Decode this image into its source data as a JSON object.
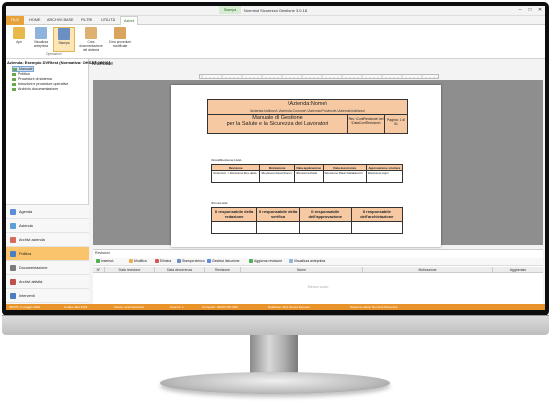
{
  "window": {
    "title": "Normind Sicurezza Gestione 3.0.18",
    "context_tab": "Stampa",
    "controls": {
      "minimize": "–",
      "maximize": "□",
      "close": "✕"
    }
  },
  "tabs": [
    {
      "label": "FILE"
    },
    {
      "label": "HOME"
    },
    {
      "label": "ARCHIVI BASE"
    },
    {
      "label": "FILTRI"
    },
    {
      "label": "UTILITÀ"
    },
    {
      "label": "Azioni"
    }
  ],
  "ribbon": {
    "buttons": [
      {
        "label": "Apri",
        "icon": "folder-open-icon",
        "color": "#e9b84a"
      },
      {
        "label": "Visualizza anteprima",
        "icon": "preview-icon",
        "color": "#8fb3dc"
      },
      {
        "label": "Stampa",
        "icon": "printer-icon",
        "color": "#6a8fc0"
      },
      {
        "label": "Crea documentazione del sistema",
        "icon": "document-create-icon",
        "color": "#e0b070"
      },
      {
        "label": "Crea procedure modificate",
        "icon": "procedure-icon",
        "color": "#d9a45e"
      }
    ],
    "group_label": "Operazioni"
  },
  "sidebar": {
    "company": "Azienda: Esempio DVRtest (Normativa: OHSAS 18001)",
    "tree": [
      {
        "label": "Manuale",
        "selected": true
      },
      {
        "label": "Politica",
        "selected": false
      },
      {
        "label": "Procedure di sistema",
        "selected": false
      },
      {
        "label": "Istruzioni e procedure operative",
        "selected": false
      },
      {
        "label": "Archivio documentazione",
        "selected": false
      }
    ],
    "nav": [
      {
        "label": "Agenda",
        "color": "#5b8ed6"
      },
      {
        "label": "Azienda",
        "color": "#5ba0d6"
      },
      {
        "label": "Archivi azienda",
        "color": "#d66b5b"
      },
      {
        "label": "Politica",
        "color": "#4a7fc1"
      },
      {
        "label": "Documentazione",
        "color": "#7a7a7a"
      },
      {
        "label": "Archivi attività",
        "color": "#c0504d"
      },
      {
        "label": "Interventi",
        "color": "#4a7fc1"
      }
    ]
  },
  "main": {
    "title": "Manuale"
  },
  "document": {
    "azienda_nome": "\\Azienda:Nome\\",
    "azienda_indirizzo": "\\Azienda:Indirizzo\\ \\Azienda:Comune\\ \\Azienda:Provincia\\ \\Azienda:Indirizzo\\",
    "title_line1": "Manuale di Gestione",
    "title_line2": "per la Salute e la Sicurezza dei Lavoratori",
    "rev_info": "Rev. \\ContRevisione\\ del \\DataContRevisione\\",
    "pagina": "Pagina: 1 di 51",
    "grand_revision_tag": "\\GrandRevisione:Lista\\",
    "rev_headers": [
      "Revisione",
      "Motivazione",
      "Data applicazione",
      "Data decorrenza",
      "Approvazione struttura"
    ],
    "rev_row": [
      "\\Grandmit...\\ \\Revisione:Rev data\\",
      "\\Revisione:Descrizione\\",
      "\\Revisione:Data\\",
      "\\Revisione:Data\\ \\DataDecorr\\",
      "\\Revisione:Appr\\"
    ],
    "filter_tag": "\\Firma:Lista\\",
    "resp_headers": [
      "Il responsabile della redazione",
      "Il responsabile della verifica",
      "Il responsabile dell'approvazione",
      "Il responsabile dell'archiviazione"
    ]
  },
  "revisions": {
    "title": "Revisioni",
    "toolbar": [
      {
        "label": "Inserisci",
        "color": "#4caf50"
      },
      {
        "label": "Modifica",
        "color": "#f0ad4e"
      },
      {
        "label": "Elimina",
        "color": "#d9534f"
      },
      {
        "label": "Stampa elenco",
        "color": "#6a8fc0"
      },
      {
        "label": "Gestisci istruzione",
        "color": "#5b8ed6"
      },
      {
        "label": "Aggiorna revisione",
        "color": "#4caf50"
      },
      {
        "label": "Visualizza anteprima",
        "color": "#8fb3dc"
      }
    ],
    "columns": [
      "N°",
      "Data revisione",
      "Data decorrenza",
      "Revisione",
      "Nome",
      "Motivazione",
      "Aggiornato"
    ],
    "empty_text": "Elenco vuoto"
  },
  "statusbar": [
    "IDPC5 | 3 maggio 2020",
    "Codice ditta 3425",
    "Utente: amministratore",
    "Licenze: 1",
    "Computer: DESKTOP-AB2",
    "Database: SQL Server Express",
    "Sessione attiva: Normind Sicurezza"
  ]
}
